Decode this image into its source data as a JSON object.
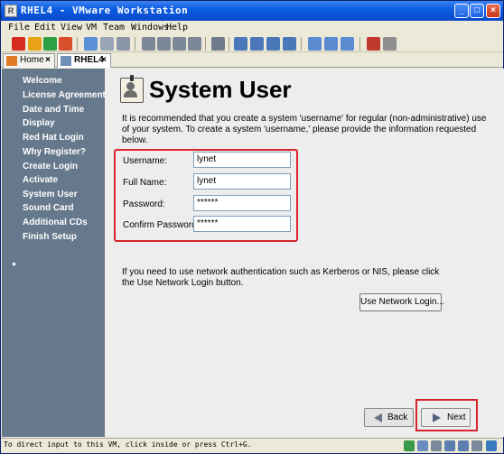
{
  "window": {
    "title": "RHEL4 - VMware Workstation",
    "icon_label": "R"
  },
  "menubar": {
    "items": [
      "File",
      "Edit",
      "View",
      "VM",
      "Team",
      "Windows",
      "Help"
    ]
  },
  "tabs": [
    {
      "label": "Home",
      "close": "×"
    },
    {
      "label": "RHEL4",
      "close": "×"
    }
  ],
  "sidebar": {
    "items": [
      "Welcome",
      "License Agreement",
      "Date and Time",
      "Display",
      "Red Hat Login",
      "Why Register?",
      "Create Login",
      "Activate",
      "System User",
      "Sound Card",
      "Additional CDs",
      "Finish Setup"
    ],
    "current_index": 8,
    "current_marker": "▸"
  },
  "page": {
    "title": "System User",
    "intro": "It is recommended that you create a system 'username' for regular (non-administrative) use of your system. To create a system 'username,' please provide the information requested below."
  },
  "form": {
    "username_label": "Username:",
    "username_value": "lynet",
    "fullname_label": "Full Name:",
    "fullname_value": "lynet",
    "password_label": "Password:",
    "password_value": "******",
    "confirm_label": "Confirm Password:",
    "confirm_value": "******"
  },
  "network": {
    "text": "If you need to use network authentication such as Kerberos or NIS, please click the Use Network Login button.",
    "button_label": "Use Network Login..."
  },
  "nav": {
    "back_label": "Back",
    "next_label": "Next"
  },
  "statusbar": {
    "text": "To direct input to this VM, click inside or press Ctrl+G."
  },
  "colors": {
    "sidebar_bg": "#66788c",
    "highlight": "#d8242c",
    "titlebar": "#0a5ae0"
  }
}
